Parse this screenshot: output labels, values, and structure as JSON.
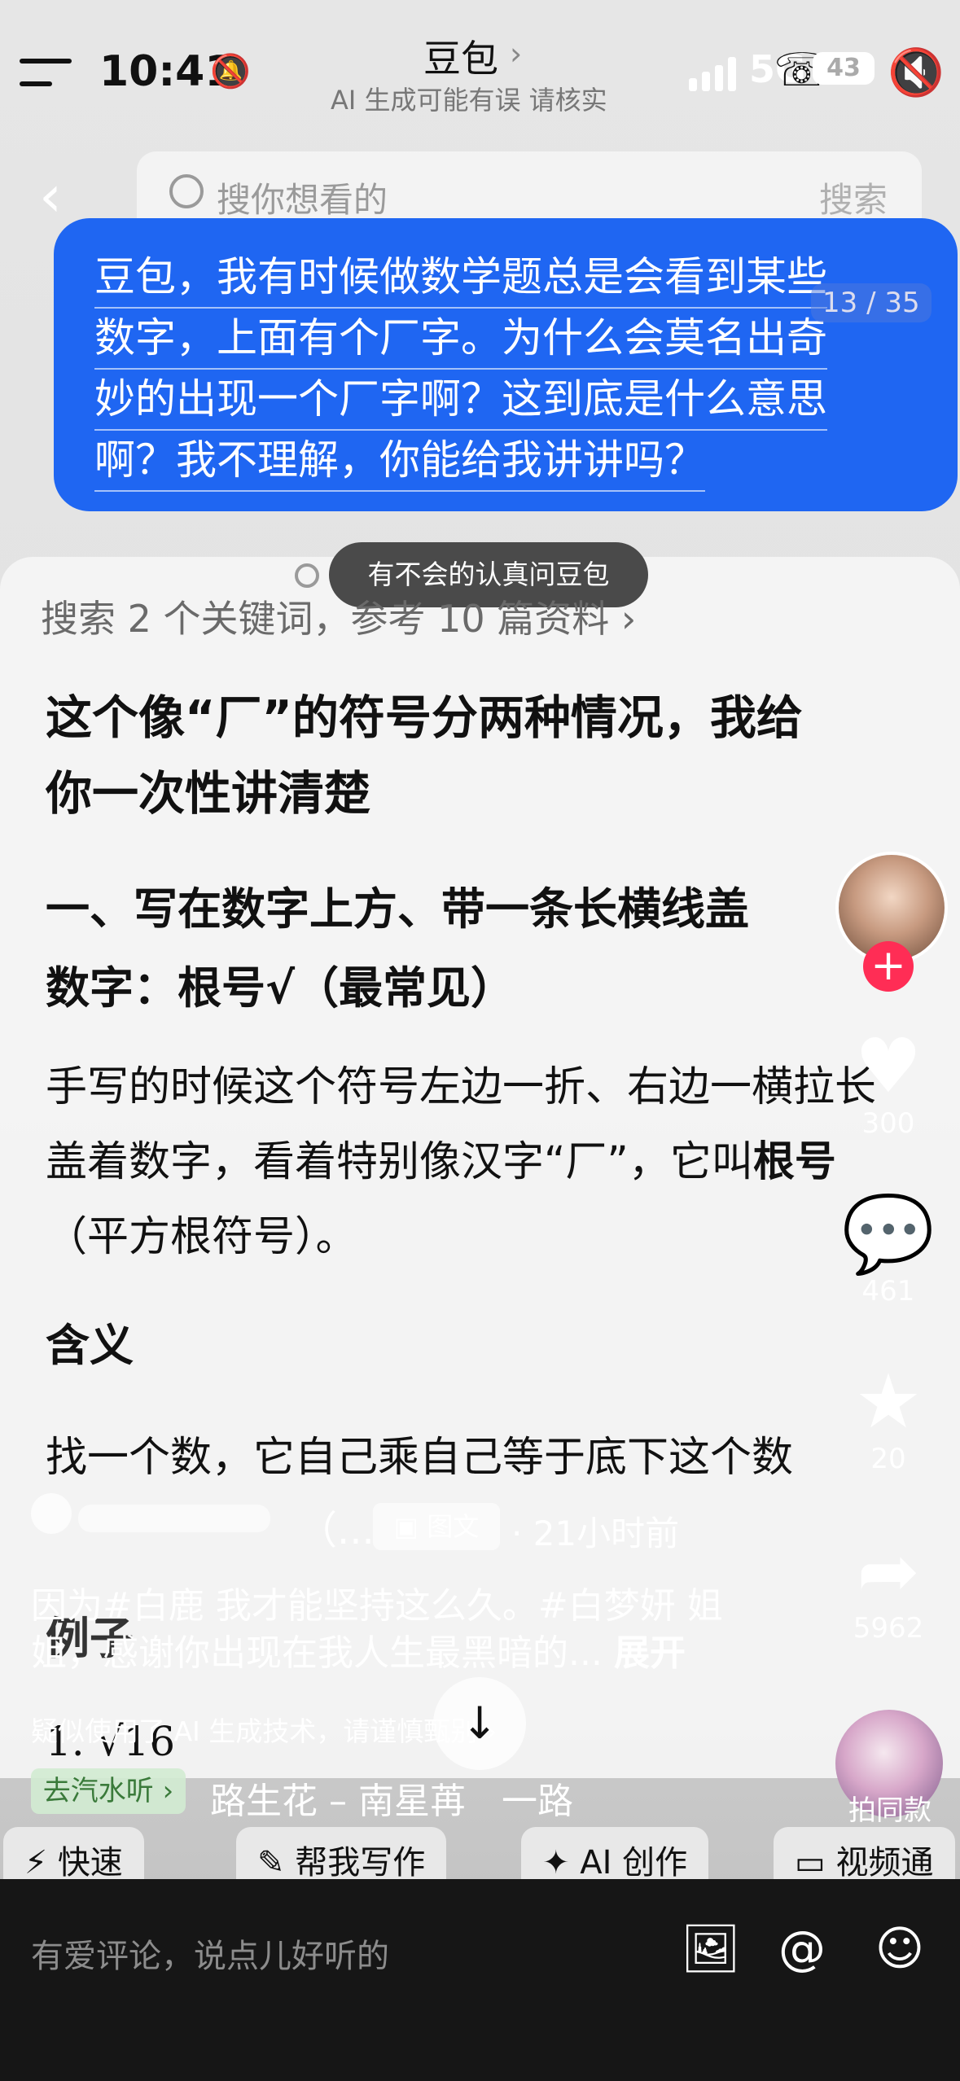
{
  "status_bar": {
    "time": "10:41",
    "network": "5G",
    "battery": "43"
  },
  "header": {
    "title": "豆包",
    "subtitle": "AI 生成可能有误 请核实"
  },
  "search": {
    "placeholder": "搜你想看的",
    "button_label": "搜索"
  },
  "question": {
    "lines": [
      "豆包，我有时候做数学题总是会看到某些",
      "数字，上面有个厂字。为什么会莫名出奇",
      "妙的出现一个厂字啊？这到底是什么意思",
      "啊？我不理解，你能给我讲讲吗？"
    ],
    "page_indicator": "13 / 35"
  },
  "toast": "有不会的认真问豆包",
  "answer": {
    "refs": "搜索 2 个关键词，参考 10 篇资料",
    "heading": [
      "这个像“厂”的符号分两种情况，我给",
      "你一次性讲清楚"
    ],
    "section1": [
      "一、写在数字上方、带一条长横线盖",
      "数字：根号√（最常见）"
    ],
    "para1_a": "手写的时候这个符号左边一折、右边一横拉长盖着数字，看着特别像汉字“厂”，它叫",
    "para1_b": "根号",
    "para1_c": "（平方根符号）。",
    "meaning_label": "含义",
    "meaning_text": "找一个数，它自己乘自己等于底下这个数",
    "example_label": "例子",
    "example_text": "1. √16"
  },
  "post": {
    "author_suffix": "（...",
    "badge": "图文",
    "time_ago": "· 21小时前",
    "caption": [
      "因为#白鹿 我才能坚持这么久。#白梦妍 姐",
      "姐，感谢你出现在我人生最黑暗的..."
    ],
    "expand": "展开",
    "ai_notice": "疑似使用了 AI 生成技术，请谨慎甄别 ›",
    "music_tag": "去汽水听 ›",
    "song": "路生花 – 南星苒　一路"
  },
  "rail": {
    "like_count": "300",
    "comment_count": "461",
    "favorite_count": "20",
    "share_count": "5962",
    "same_label": "拍同款"
  },
  "chips": [
    "快速",
    "帮我写作",
    "AI 创作",
    "视频通"
  ],
  "comment_bar": {
    "placeholder": "有爱评论，说点儿好听的"
  }
}
